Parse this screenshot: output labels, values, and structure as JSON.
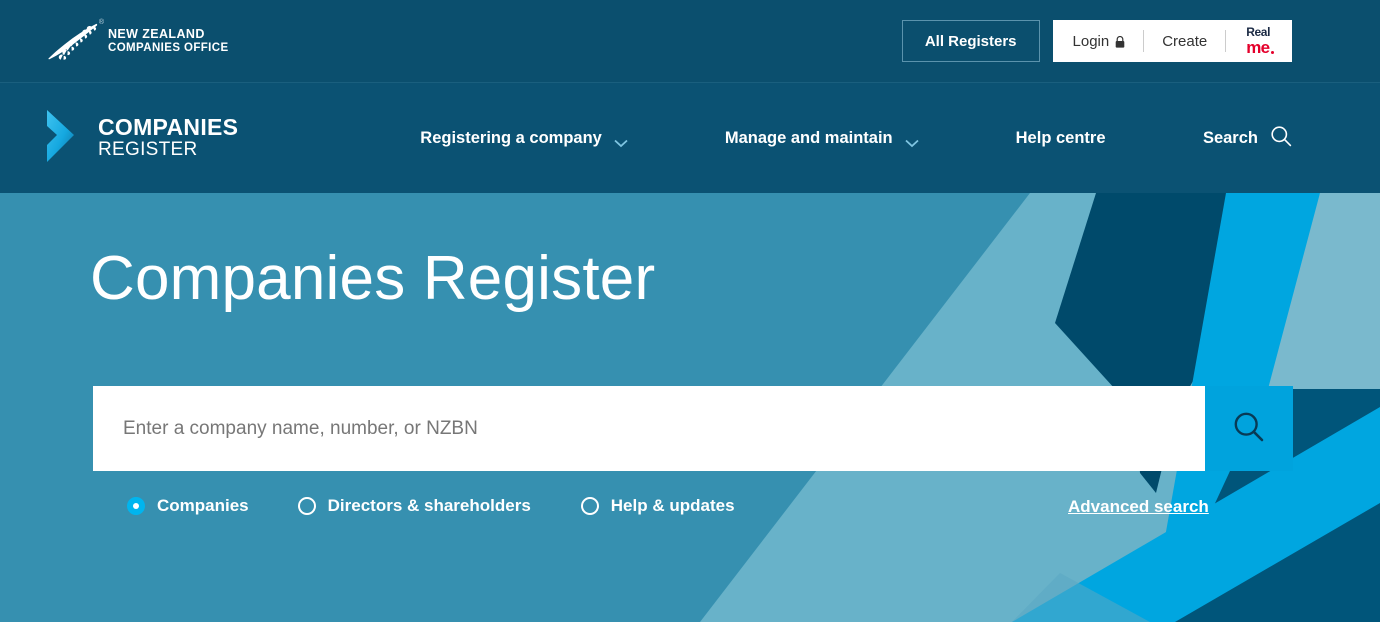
{
  "topbar": {
    "logo": {
      "icon": "silver-fern-icon",
      "registered_mark": "®",
      "line1": "NEW ZEALAND",
      "line2": "COMPANIES OFFICE"
    },
    "all_registers_label": "All Registers",
    "login_label": "Login",
    "login_icon": "lock-icon",
    "create_label": "Create",
    "realme": {
      "word1": "Real",
      "word2": "me"
    }
  },
  "mainnav": {
    "logo": {
      "icon": "chevron-right-logo-icon",
      "line1": "COMPANIES",
      "line2": "REGISTER"
    },
    "links": [
      {
        "label": "Registering a company",
        "icon": "chevron-down-icon",
        "has_dropdown": true
      },
      {
        "label": "Manage and maintain",
        "icon": "chevron-down-icon",
        "has_dropdown": true
      },
      {
        "label": "Help centre",
        "has_dropdown": false
      }
    ],
    "search_label": "Search",
    "search_icon": "search-icon"
  },
  "hero": {
    "title": "Companies Register",
    "search": {
      "placeholder": "Enter a company name, number, or NZBN",
      "value": "",
      "button_icon": "search-icon"
    },
    "filters": [
      {
        "label": "Companies",
        "selected": true
      },
      {
        "label": "Directors & shareholders",
        "selected": false
      },
      {
        "label": "Help & updates",
        "selected": false
      }
    ],
    "advanced_search_label": "Advanced search"
  },
  "colors": {
    "topbar_bg": "#0b4f6e",
    "nav_bg": "#0b5273",
    "hero_base": "#3690b0",
    "hero_dark": "#004a6b",
    "hero_cyan": "#00a6e0",
    "hero_light": "#68b2c9",
    "accent_cyan": "#00a3dd",
    "realme_red": "#e4002b",
    "white": "#ffffff"
  }
}
